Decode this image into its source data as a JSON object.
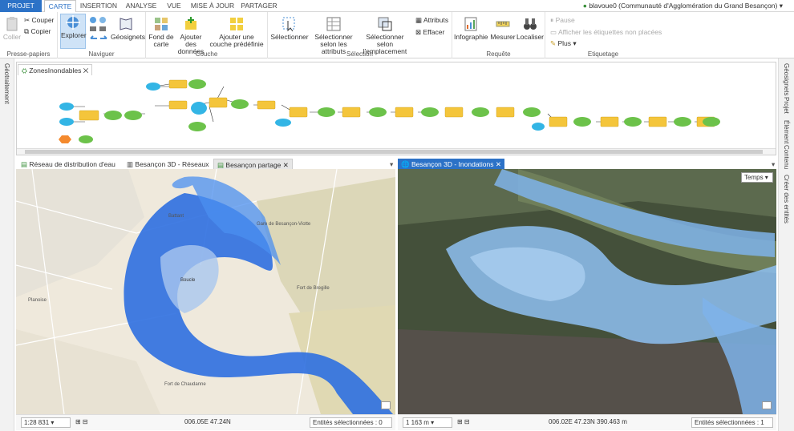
{
  "tabs": [
    "PROJET",
    "CARTE",
    "INSERTION",
    "ANALYSE",
    "VUE",
    "MISE À JOUR",
    "PARTAGER"
  ],
  "user": "blavoue0 (Communauté d'Agglomération du Grand Besançon)",
  "ribbon": {
    "clipboard": {
      "paste": "Coller",
      "cut": "Couper",
      "copy": "Copier",
      "label": "Presse-papiers"
    },
    "navigate": {
      "explore": "Explorer",
      "bookmarks": "Géosignets",
      "label": "Naviguer"
    },
    "layer": {
      "basemap": "Fond de carte",
      "add_data": "Ajouter des données",
      "add_preset": "Ajouter une couche prédéfinie",
      "label": "Couche"
    },
    "selection": {
      "select": "Sélectionner",
      "by_attr": "Sélectionner selon les attributs",
      "by_loc": "Sélectionner selon l'emplacement",
      "attributes": "Attributs",
      "clear": "Effacer",
      "label": "Sélection"
    },
    "query": {
      "infographic": "Infographie",
      "measure": "Mesurer",
      "locate": "Localiser",
      "label": "Requête"
    },
    "labeling": {
      "pause": "Pause",
      "unplaced": "Afficher les étiquettes non placées",
      "more": "Plus",
      "label": "Etiquetage"
    }
  },
  "left_sidebar": "Géotraitement",
  "right_sidebar": [
    "Géosignets",
    "Projet",
    "Élément",
    "Contenu",
    "Créer des entités"
  ],
  "model_tab": "ZonesInondables",
  "views_left": [
    "Réseau de distribution d'eau",
    "Besançon 3D - Réseaux",
    "Besançon partage"
  ],
  "view_right": "Besançon 3D - Inondations",
  "time_btn": "Temps",
  "status_left": {
    "scale": "1:28 831",
    "coords": "006.05E 47.24N",
    "selected": "Entités sélectionnées : 0"
  },
  "status_right": {
    "scale": "1 163 m",
    "coords": "006.02E 47.23N  390.463 m",
    "selected": "Entités sélectionnées : 1"
  },
  "map_labels": [
    "Gare de Besançon-Viotte",
    "Battant",
    "Boucle",
    "Fort de Bregille",
    "Fort de Chaudanne",
    "Planoise"
  ]
}
